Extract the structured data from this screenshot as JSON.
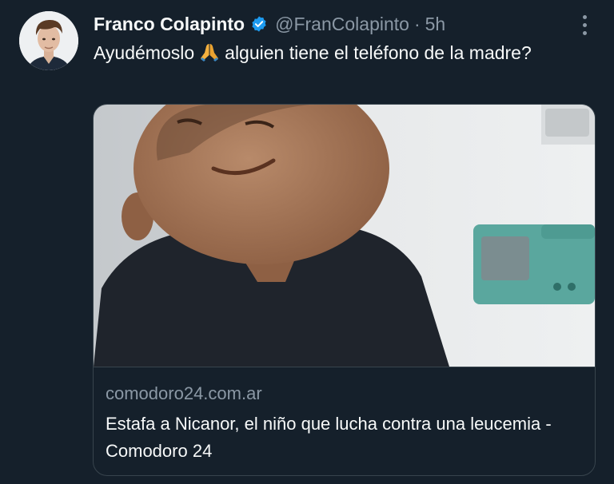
{
  "tweet": {
    "author_name": "Franco Colapinto",
    "handle": "@FranColapinto",
    "separator": "·",
    "time": "5h",
    "text_before": "Ayudémoslo",
    "emoji": "🙏",
    "text_after": "alguien tiene el teléfono de la madre?"
  },
  "link_card": {
    "domain": "comodoro24.com.ar",
    "title": "Estafa a Nicanor, el niño que lucha contra una leucemia - Comodoro 24"
  },
  "colors": {
    "background": "#15202b",
    "verified": "#1d9bf0",
    "secondary_text": "#8b98a5",
    "border": "#38444d"
  },
  "icons": {
    "verified": "verified-badge-icon",
    "more": "more-options-icon",
    "emoji": "folded-hands-emoji-icon"
  }
}
